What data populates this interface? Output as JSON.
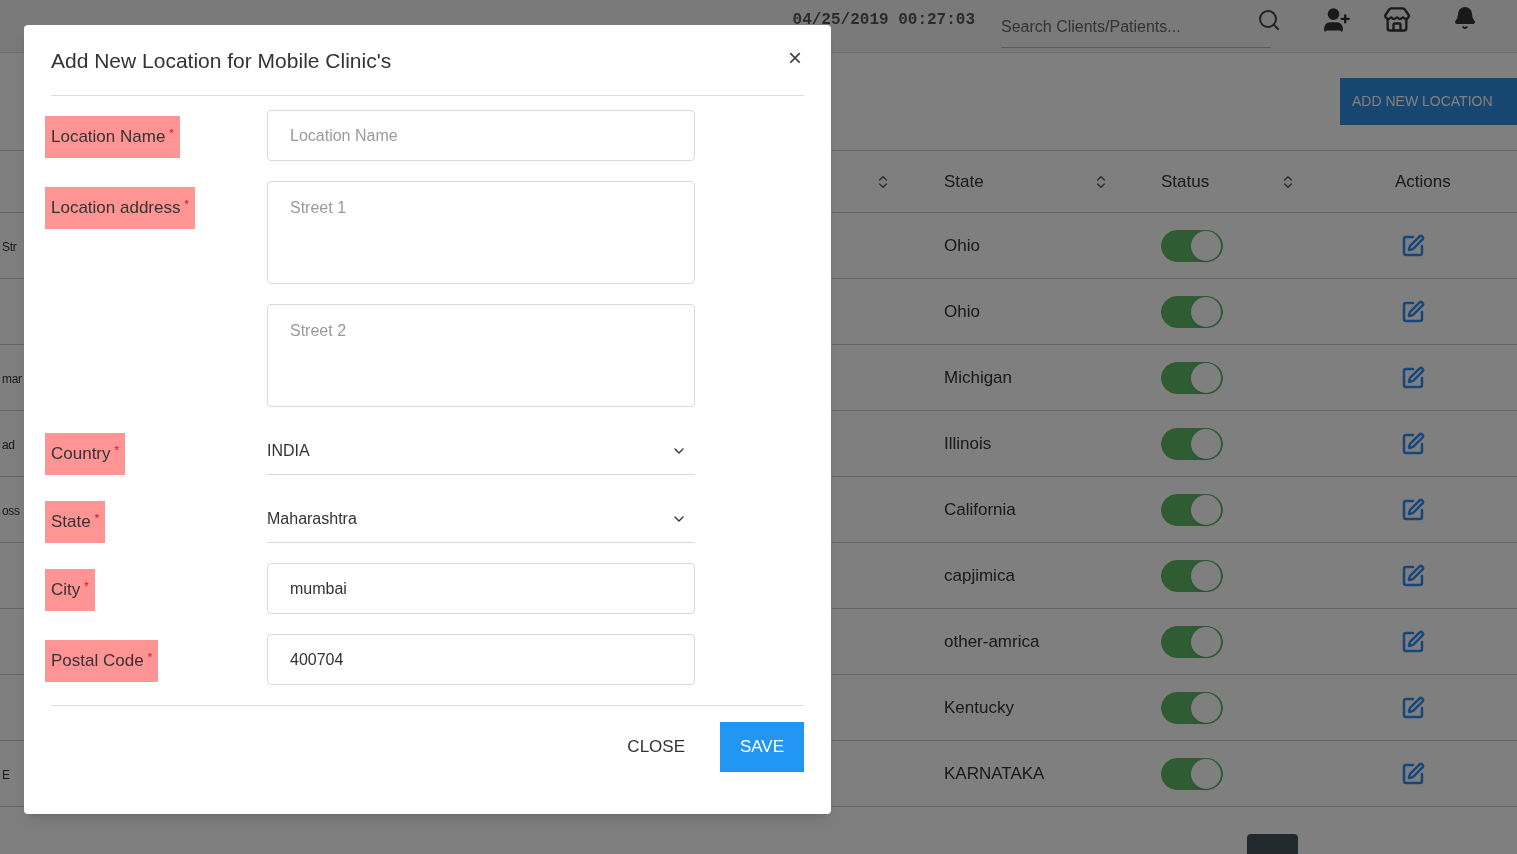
{
  "topbar": {
    "datetime": "04/25/2019 00:27:03",
    "search": {
      "placeholder": "Search Clients/Patients..."
    }
  },
  "add_button": "ADD NEW LOCATION",
  "table": {
    "columns": [
      {
        "sortable": true
      },
      {
        "label": "State",
        "sortable": true
      },
      {
        "label": "Status",
        "sortable": true
      },
      {
        "label": "Actions",
        "sortable": false
      }
    ],
    "rows": [
      {
        "column_1": "Str",
        "state": "Ohio",
        "on": true
      },
      {
        "state": "Ohio",
        "on": true
      },
      {
        "column_1": "mar",
        "state": "Michigan",
        "on": true
      },
      {
        "column_1": "ad",
        "state": "Illinois",
        "on": true
      },
      {
        "column_1": "oss",
        "state": "California",
        "on": true
      },
      {
        "state": "capjimica",
        "on": true
      },
      {
        "state": "other-amrica",
        "on": true
      },
      {
        "state": "Kentucky",
        "on": true
      },
      {
        "column_1": "E",
        "state": "KARNATAKA",
        "on": true
      }
    ]
  },
  "modal": {
    "title": "Add New Location for Mobile Clinic's",
    "close_glyph": "×",
    "fields": [
      {
        "label": "Location Name",
        "mark": "*",
        "inputs": [
          {
            "kind": "text",
            "placeholder": "Location Name"
          }
        ]
      },
      {
        "label": "Location address",
        "mark": "*",
        "inputs": [
          {
            "kind": "textarea",
            "placeholder": "Street 1"
          },
          {
            "kind": "textarea",
            "placeholder": "Street 2"
          }
        ]
      },
      {
        "label": "Country",
        "mark": "*",
        "inputs": [
          {
            "kind": "select",
            "value": "INDIA"
          }
        ]
      },
      {
        "label": "State",
        "mark": "*",
        "inputs": [
          {
            "kind": "select",
            "value": "Maharashtra"
          }
        ]
      },
      {
        "label": "City",
        "mark": "*",
        "inputs": [
          {
            "kind": "text",
            "value": "mumbai"
          }
        ]
      },
      {
        "label": "Postal Code",
        "mark": "*",
        "inputs": [
          {
            "kind": "text",
            "value": "400704"
          }
        ]
      }
    ],
    "buttons": {
      "close": "CLOSE",
      "save": "SAVE"
    }
  }
}
